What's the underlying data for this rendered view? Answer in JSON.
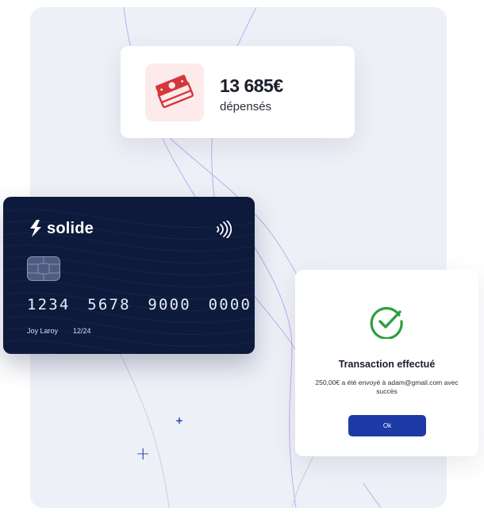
{
  "spending": {
    "amount": "13 685€",
    "label": "dépensés",
    "icon": "money-stack-icon"
  },
  "card": {
    "brand": "solide",
    "number": "1234 5678 9000 0000",
    "holder": "Joy Laroy",
    "expiry": "12/24",
    "icons": [
      "solide-logo-icon",
      "contactless-icon",
      "chip-icon"
    ]
  },
  "transaction": {
    "title": "Transaction effectué",
    "message": "250,00€ a été envoyé à adam@gmail.com avec succès",
    "button": "Ok",
    "icon": "check-circle-icon"
  },
  "colors": {
    "accent": "#1d3aa6",
    "card_bg": "#0e1a3c",
    "success": "#2e9e3e",
    "danger": "#d6373a",
    "panel_bg": "#eef0f7"
  }
}
